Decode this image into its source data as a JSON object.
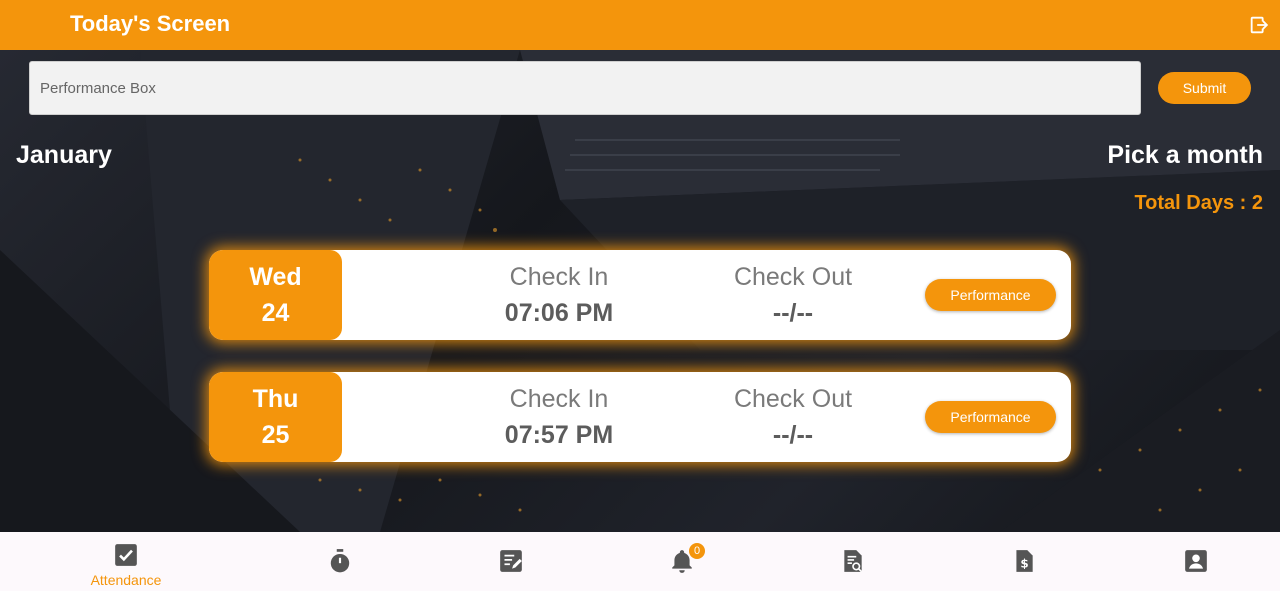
{
  "app": {
    "title": "Today's Screen"
  },
  "colors": {
    "accent": "#f4950c",
    "card_bg": "#ffffff",
    "background": "#1b1d24"
  },
  "icons": {
    "logout": "logout-icon",
    "attendance": "checkbox-icon",
    "timer": "stopwatch-icon",
    "report": "document-edit-icon",
    "notifications": "bell-icon",
    "review": "document-search-icon",
    "salary": "invoice-dollar-icon",
    "profile": "account-box-icon"
  },
  "performance_box": {
    "placeholder": "Performance Box",
    "value": ""
  },
  "submit_label": "Submit",
  "month": "January",
  "pick_month_label": "Pick a month",
  "total_days": "Total Days : 2",
  "records": [
    {
      "dow": "Wed",
      "day": "24",
      "check_in_label": "Check In",
      "check_in": "07:06 PM",
      "check_out_label": "Check Out",
      "check_out": "--/--",
      "performance_label": "Performance"
    },
    {
      "dow": "Thu",
      "day": "25",
      "check_in_label": "Check In",
      "check_in": "07:57 PM",
      "check_out_label": "Check Out",
      "check_out": "--/--",
      "performance_label": "Performance"
    }
  ],
  "nav": {
    "attendance_label": "Attendance",
    "notification_count": "0"
  }
}
